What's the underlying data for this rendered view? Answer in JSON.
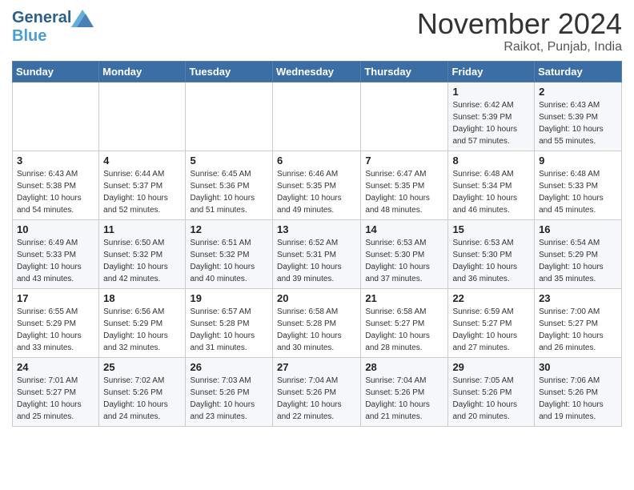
{
  "header": {
    "logo_general": "General",
    "logo_blue": "Blue",
    "month_title": "November 2024",
    "location": "Raikot, Punjab, India"
  },
  "weekdays": [
    "Sunday",
    "Monday",
    "Tuesday",
    "Wednesday",
    "Thursday",
    "Friday",
    "Saturday"
  ],
  "weeks": [
    [
      {
        "day": "",
        "info": ""
      },
      {
        "day": "",
        "info": ""
      },
      {
        "day": "",
        "info": ""
      },
      {
        "day": "",
        "info": ""
      },
      {
        "day": "",
        "info": ""
      },
      {
        "day": "1",
        "info": "Sunrise: 6:42 AM\nSunset: 5:39 PM\nDaylight: 10 hours and 57 minutes."
      },
      {
        "day": "2",
        "info": "Sunrise: 6:43 AM\nSunset: 5:39 PM\nDaylight: 10 hours and 55 minutes."
      }
    ],
    [
      {
        "day": "3",
        "info": "Sunrise: 6:43 AM\nSunset: 5:38 PM\nDaylight: 10 hours and 54 minutes."
      },
      {
        "day": "4",
        "info": "Sunrise: 6:44 AM\nSunset: 5:37 PM\nDaylight: 10 hours and 52 minutes."
      },
      {
        "day": "5",
        "info": "Sunrise: 6:45 AM\nSunset: 5:36 PM\nDaylight: 10 hours and 51 minutes."
      },
      {
        "day": "6",
        "info": "Sunrise: 6:46 AM\nSunset: 5:35 PM\nDaylight: 10 hours and 49 minutes."
      },
      {
        "day": "7",
        "info": "Sunrise: 6:47 AM\nSunset: 5:35 PM\nDaylight: 10 hours and 48 minutes."
      },
      {
        "day": "8",
        "info": "Sunrise: 6:48 AM\nSunset: 5:34 PM\nDaylight: 10 hours and 46 minutes."
      },
      {
        "day": "9",
        "info": "Sunrise: 6:48 AM\nSunset: 5:33 PM\nDaylight: 10 hours and 45 minutes."
      }
    ],
    [
      {
        "day": "10",
        "info": "Sunrise: 6:49 AM\nSunset: 5:33 PM\nDaylight: 10 hours and 43 minutes."
      },
      {
        "day": "11",
        "info": "Sunrise: 6:50 AM\nSunset: 5:32 PM\nDaylight: 10 hours and 42 minutes."
      },
      {
        "day": "12",
        "info": "Sunrise: 6:51 AM\nSunset: 5:32 PM\nDaylight: 10 hours and 40 minutes."
      },
      {
        "day": "13",
        "info": "Sunrise: 6:52 AM\nSunset: 5:31 PM\nDaylight: 10 hours and 39 minutes."
      },
      {
        "day": "14",
        "info": "Sunrise: 6:53 AM\nSunset: 5:30 PM\nDaylight: 10 hours and 37 minutes."
      },
      {
        "day": "15",
        "info": "Sunrise: 6:53 AM\nSunset: 5:30 PM\nDaylight: 10 hours and 36 minutes."
      },
      {
        "day": "16",
        "info": "Sunrise: 6:54 AM\nSunset: 5:29 PM\nDaylight: 10 hours and 35 minutes."
      }
    ],
    [
      {
        "day": "17",
        "info": "Sunrise: 6:55 AM\nSunset: 5:29 PM\nDaylight: 10 hours and 33 minutes."
      },
      {
        "day": "18",
        "info": "Sunrise: 6:56 AM\nSunset: 5:29 PM\nDaylight: 10 hours and 32 minutes."
      },
      {
        "day": "19",
        "info": "Sunrise: 6:57 AM\nSunset: 5:28 PM\nDaylight: 10 hours and 31 minutes."
      },
      {
        "day": "20",
        "info": "Sunrise: 6:58 AM\nSunset: 5:28 PM\nDaylight: 10 hours and 30 minutes."
      },
      {
        "day": "21",
        "info": "Sunrise: 6:58 AM\nSunset: 5:27 PM\nDaylight: 10 hours and 28 minutes."
      },
      {
        "day": "22",
        "info": "Sunrise: 6:59 AM\nSunset: 5:27 PM\nDaylight: 10 hours and 27 minutes."
      },
      {
        "day": "23",
        "info": "Sunrise: 7:00 AM\nSunset: 5:27 PM\nDaylight: 10 hours and 26 minutes."
      }
    ],
    [
      {
        "day": "24",
        "info": "Sunrise: 7:01 AM\nSunset: 5:27 PM\nDaylight: 10 hours and 25 minutes."
      },
      {
        "day": "25",
        "info": "Sunrise: 7:02 AM\nSunset: 5:26 PM\nDaylight: 10 hours and 24 minutes."
      },
      {
        "day": "26",
        "info": "Sunrise: 7:03 AM\nSunset: 5:26 PM\nDaylight: 10 hours and 23 minutes."
      },
      {
        "day": "27",
        "info": "Sunrise: 7:04 AM\nSunset: 5:26 PM\nDaylight: 10 hours and 22 minutes."
      },
      {
        "day": "28",
        "info": "Sunrise: 7:04 AM\nSunset: 5:26 PM\nDaylight: 10 hours and 21 minutes."
      },
      {
        "day": "29",
        "info": "Sunrise: 7:05 AM\nSunset: 5:26 PM\nDaylight: 10 hours and 20 minutes."
      },
      {
        "day": "30",
        "info": "Sunrise: 7:06 AM\nSunset: 5:26 PM\nDaylight: 10 hours and 19 minutes."
      }
    ]
  ]
}
